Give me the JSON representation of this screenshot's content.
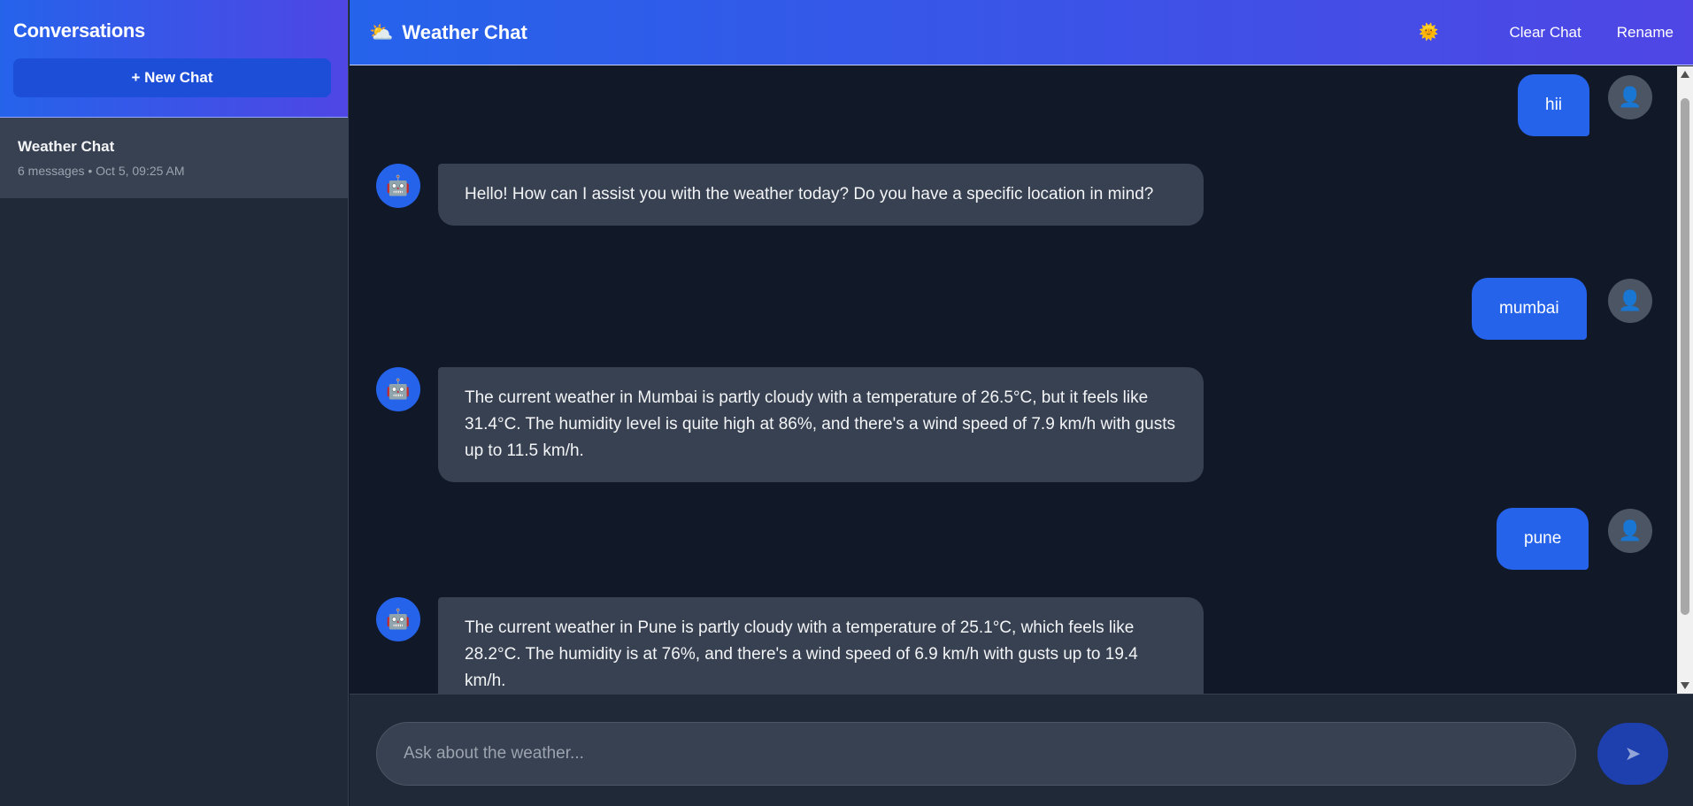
{
  "sidebar": {
    "title": "Conversations",
    "new_chat_label": "+ New Chat",
    "conversations": [
      {
        "title": "Weather Chat",
        "meta": "6 messages • Oct 5, 09:25 AM"
      }
    ]
  },
  "header": {
    "icon": "⛅",
    "title": "Weather Chat",
    "theme_icon": "🌞",
    "clear_label": "Clear Chat",
    "rename_label": "Rename"
  },
  "messages": [
    {
      "role": "user",
      "text": "hii"
    },
    {
      "role": "assistant",
      "text": "Hello! How can I assist you with the weather today? Do you have a specific location in mind?"
    },
    {
      "role": "user",
      "text": "mumbai"
    },
    {
      "role": "assistant",
      "text": "The current weather in Mumbai is partly cloudy with a temperature of 26.5°C, but it feels like 31.4°C. The humidity level is quite high at 86%, and there's a wind speed of 7.9 km/h with gusts up to 11.5 km/h."
    },
    {
      "role": "user",
      "text": "pune"
    },
    {
      "role": "assistant",
      "text": "The current weather in Pune is partly cloudy with a temperature of 25.1°C, which feels like 28.2°C. The humidity is at 76%, and there's a wind speed of 6.9 km/h with gusts up to 19.4 km/h."
    }
  ],
  "composer": {
    "placeholder": "Ask about the weather...",
    "send_icon": "➤"
  },
  "icons": {
    "user_avatar": "👤",
    "bot_avatar": "🤖"
  },
  "colors": {
    "accent": "#2563eb",
    "accent_2": "#4f46e5",
    "background": "#111827",
    "panel": "#1f2937",
    "bubble_assistant": "#374151"
  }
}
